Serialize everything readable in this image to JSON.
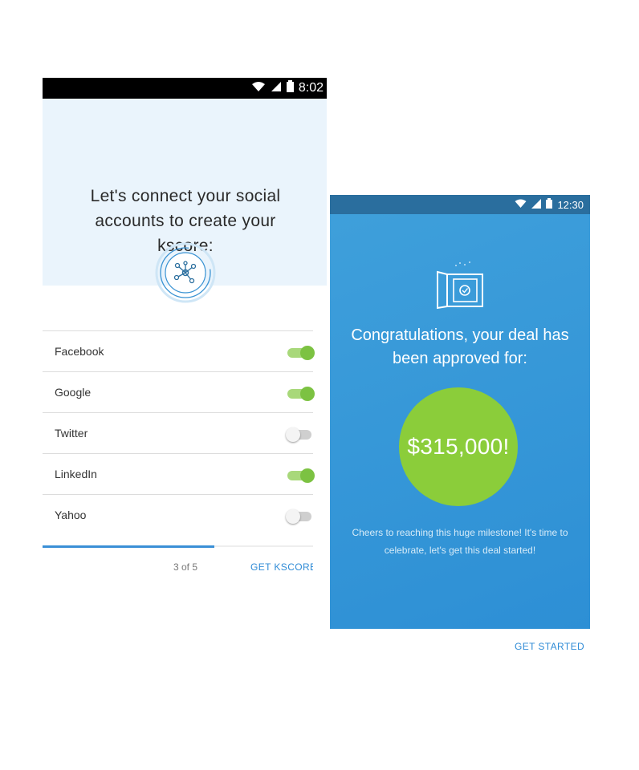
{
  "screen1": {
    "status": {
      "time": "8:02"
    },
    "title": "Let's connect your social accounts to create your kscore:",
    "accounts": [
      {
        "label": "Facebook",
        "enabled": true
      },
      {
        "label": "Google",
        "enabled": true
      },
      {
        "label": "Twitter",
        "enabled": false
      },
      {
        "label": "LinkedIn",
        "enabled": true
      },
      {
        "label": "Yahoo",
        "enabled": false
      }
    ],
    "progress": {
      "label": "3 of 5",
      "fraction": 0.6
    },
    "action": "GET KSCORE"
  },
  "screen2": {
    "status": {
      "time": "12:30"
    },
    "headline": "Congratulations, your deal has been approved for:",
    "amount": "$315,000!",
    "message": "Cheers to reaching this huge milestone! It's time to celebrate, let's get this deal started!",
    "action": "GET STARTED"
  },
  "colors": {
    "accent_blue": "#2f8bd6",
    "toggle_on": "#7cc242",
    "approved_green": "#8bcd3a",
    "card_blue": "#3a9bd9"
  }
}
